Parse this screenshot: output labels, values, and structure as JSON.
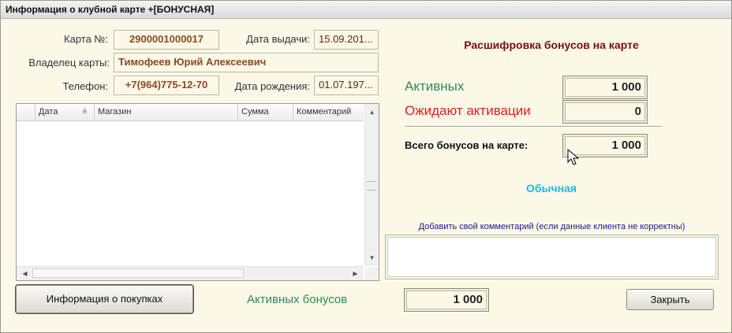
{
  "window": {
    "title": "Информация о клубной карте +[БОНУСНАЯ]"
  },
  "card": {
    "number_label": "Карта №:",
    "number_value": "2900001000017",
    "issue_date_label": "Дата выдачи:",
    "issue_date_value": "15.09.201...",
    "owner_label": "Владелец карты:",
    "owner_value": "Тимофеев Юрий Алексеевич",
    "phone_label": "Телефон:",
    "phone_value": "+7(964)775-12-70",
    "birth_date_label": "Дата рождения:",
    "birth_date_value": "01.07.197..."
  },
  "table": {
    "columns": [
      "Дата",
      "Магазин",
      "Сумма",
      "Комментарий"
    ],
    "rows": []
  },
  "bonuses": {
    "heading": "Расшифровка бонусов на карте",
    "active_label": "Активных",
    "active_value": "1 000",
    "pending_label": "Ожидают активации",
    "pending_value": "0",
    "total_label": "Всего бонусов на карте:",
    "total_value": "1 000",
    "card_type": "Обычная"
  },
  "comment": {
    "label": "Добавить свой комментарий (если данные клиента не корректны)",
    "value": ""
  },
  "footer": {
    "purchases_button": "Информация о покупках",
    "active_bonuses_label": "Активных бонусов",
    "active_bonuses_value": "1 000",
    "close_button": "Закрыть"
  },
  "colors": {
    "accent_dark_red": "#7a0f0f",
    "active_green": "#2e8b57",
    "pending_red": "#e02020",
    "type_cyan": "#1fb6e6",
    "field_text": "#8b4a22"
  },
  "icons": {
    "sort": "sort-icon",
    "scroll_up": "scroll-up-arrow-icon",
    "scroll_down": "scroll-down-arrow-icon",
    "scroll_left": "scroll-left-arrow-icon",
    "scroll_right": "scroll-right-arrow-icon",
    "cursor": "mouse-cursor-icon"
  }
}
